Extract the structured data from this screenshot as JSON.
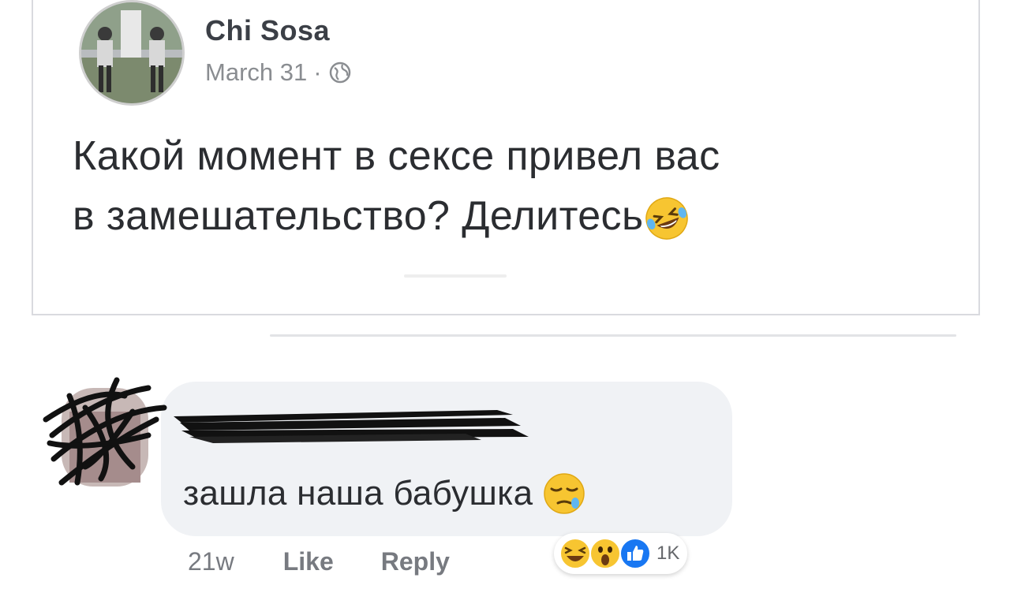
{
  "post": {
    "author": "Chi Sosa",
    "date": "March 31",
    "separator": "·",
    "privacy_icon": "globe-icon",
    "text_line1": "Какой момент в сексе привел вас",
    "text_line2": "в замешательство? Делитесь",
    "text_emoji": "rolling-on-floor-laughing"
  },
  "comment": {
    "author": "",
    "text": "зашла наша бабушка",
    "text_emoji": "sleepy-face",
    "time": "21w",
    "like_label": "Like",
    "reply_label": "Reply",
    "reactions": [
      "haha",
      "wow",
      "like"
    ],
    "reaction_count": "1K"
  },
  "colors": {
    "bubble": "#f0f2f5",
    "like_blue": "#1877f2",
    "emoji_yellow": "#f7c531",
    "text": "#2b2d31",
    "meta": "#8a8d91"
  }
}
